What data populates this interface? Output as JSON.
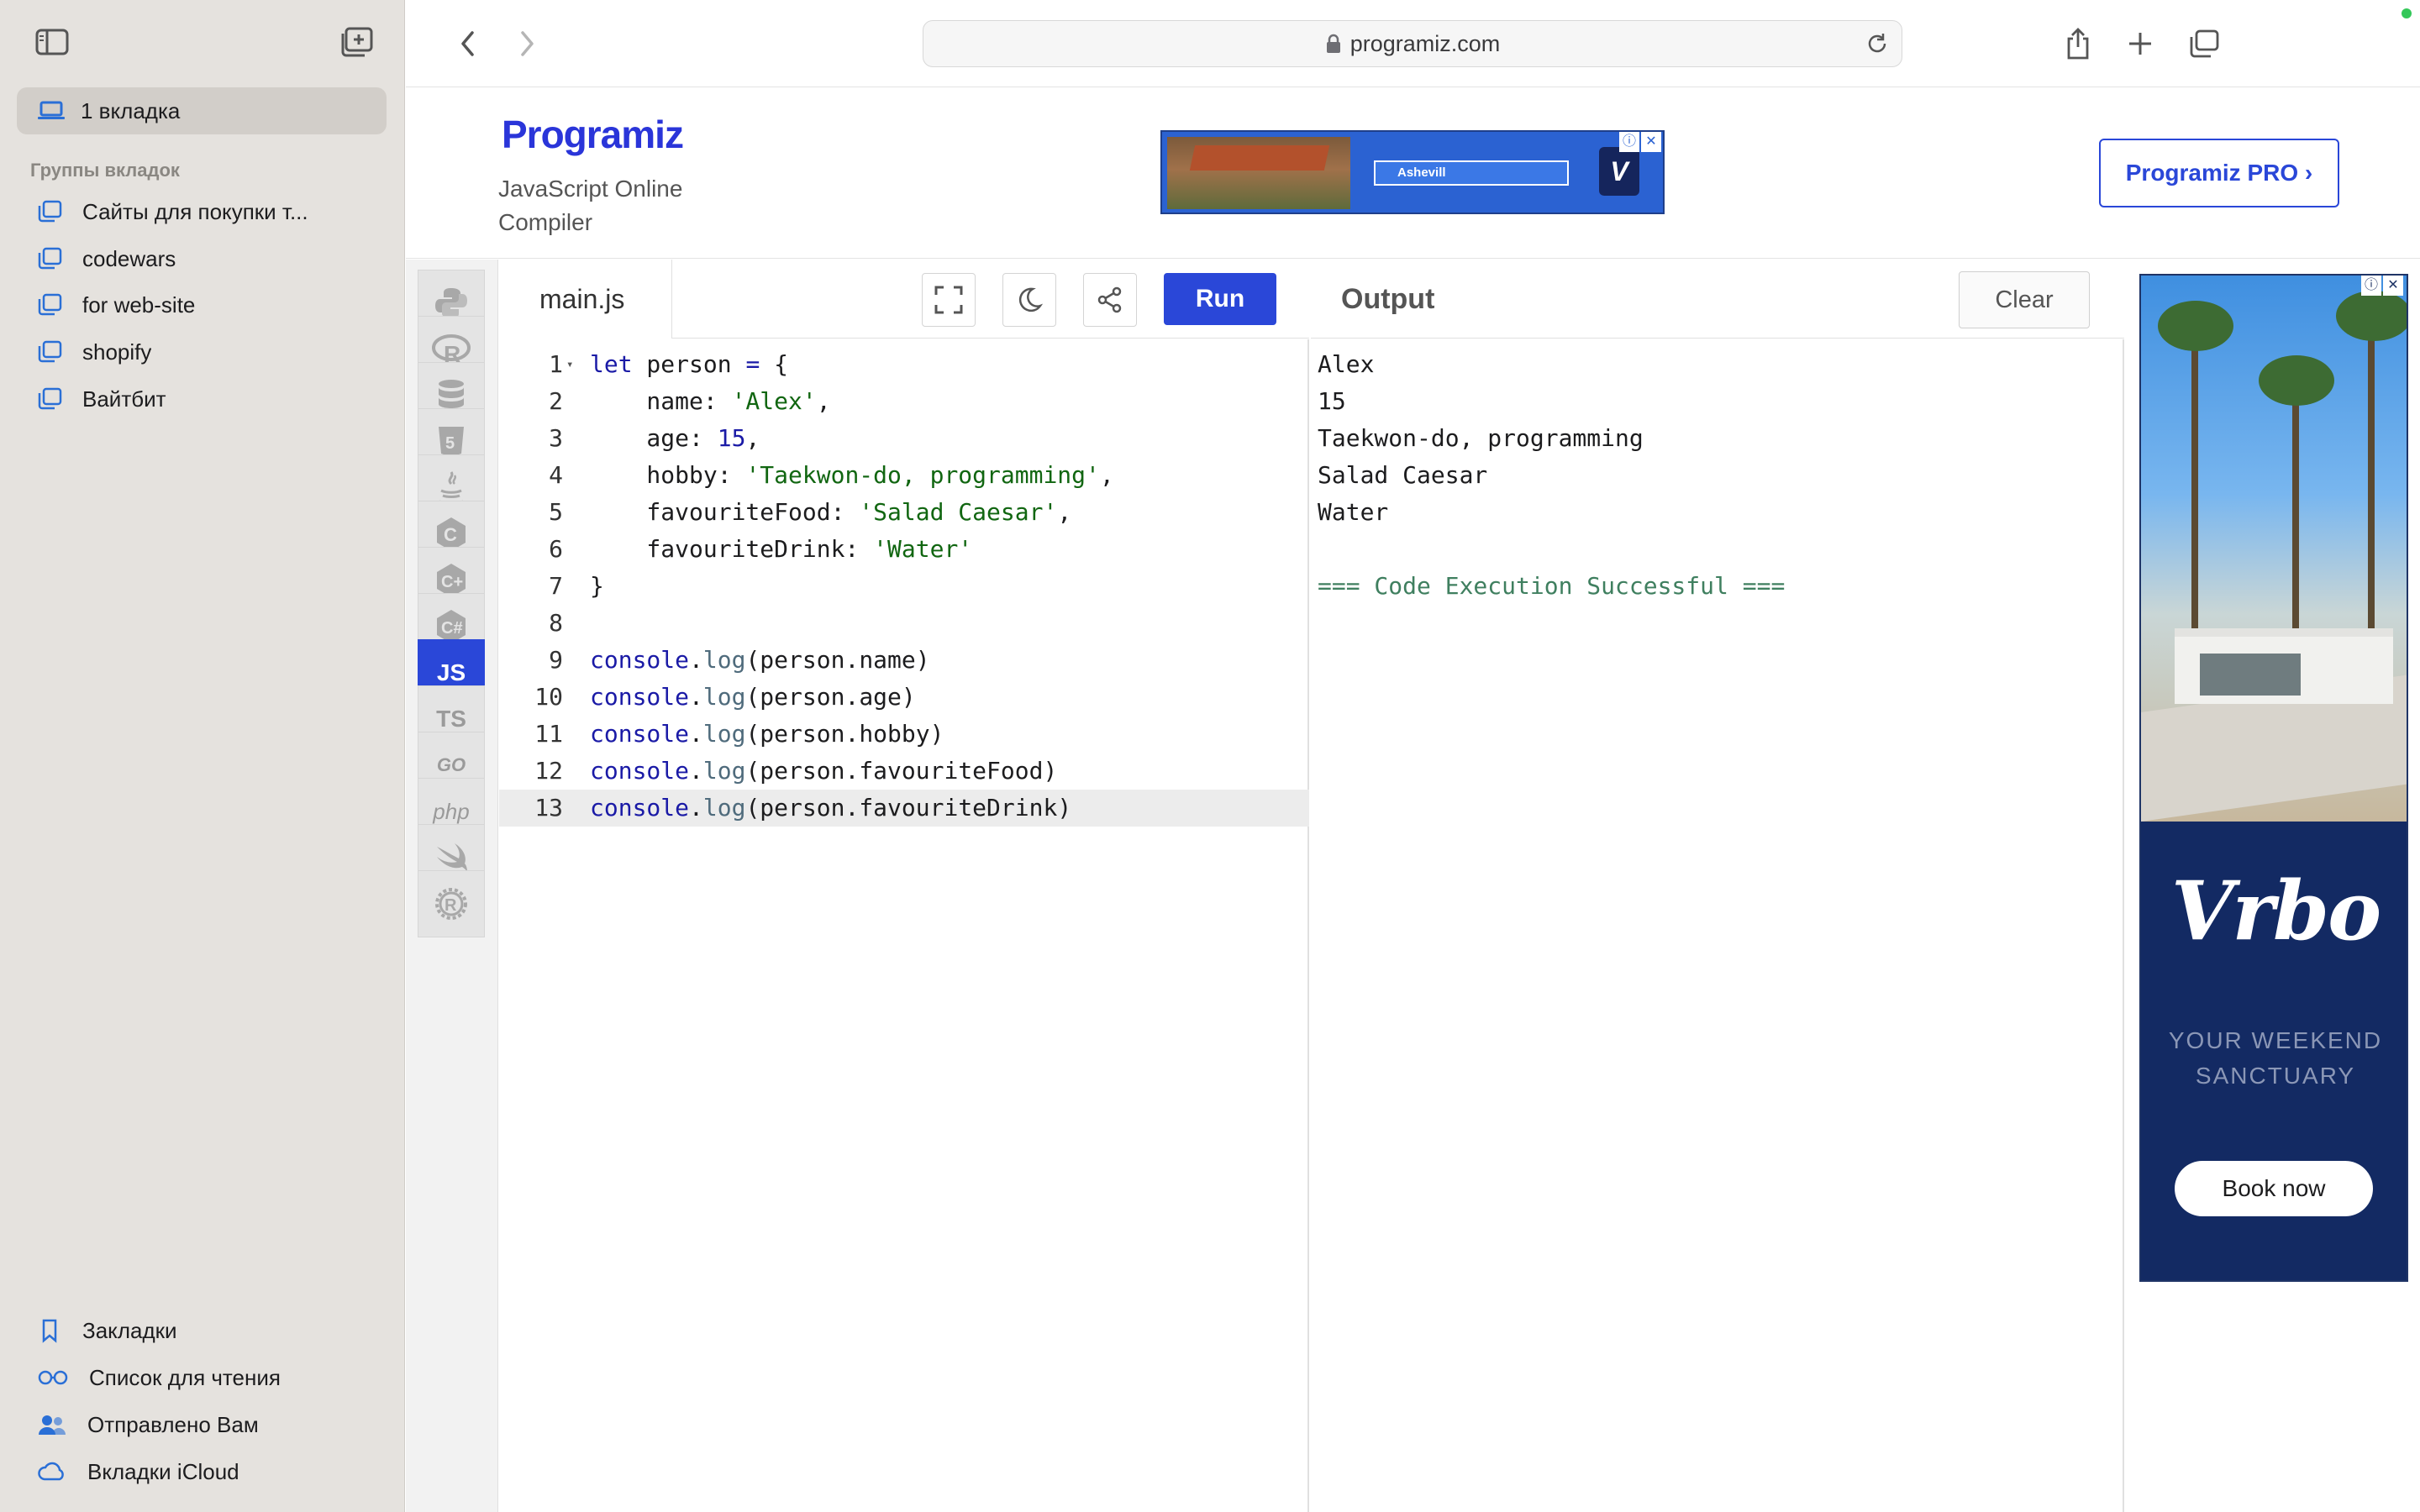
{
  "browser": {
    "url": "programiz.com"
  },
  "sidebar": {
    "active_tab_label": "1 вкладка",
    "group_section_label": "Группы вкладок",
    "groups": [
      {
        "label": "Сайты для покупки т..."
      },
      {
        "label": "codewars"
      },
      {
        "label": "for web-site"
      },
      {
        "label": "shopify"
      },
      {
        "label": "Вайтбит"
      }
    ],
    "bottom": [
      {
        "label": "Закладки",
        "icon": "bookmark-icon"
      },
      {
        "label": "Список для чтения",
        "icon": "reading-list-icon"
      },
      {
        "label": "Отправлено Вам",
        "icon": "shared-with-you-icon"
      },
      {
        "label": "Вкладки iCloud",
        "icon": "icloud-icon"
      }
    ]
  },
  "site": {
    "logo_text": "Programiz",
    "subtitle": "JavaScript Online Compiler",
    "pro_button": "Programiz PRO ›",
    "top_ad": {
      "field_text": "Ashevill"
    }
  },
  "languages": [
    {
      "name": "python",
      "icon": "python-icon",
      "label": ""
    },
    {
      "name": "r",
      "icon": "r-icon",
      "label": ""
    },
    {
      "name": "sql",
      "icon": "database-icon",
      "label": ""
    },
    {
      "name": "html",
      "icon": "html5-icon",
      "label": ""
    },
    {
      "name": "java",
      "icon": "java-icon",
      "label": ""
    },
    {
      "name": "c",
      "icon": "c-icon",
      "label": ""
    },
    {
      "name": "cpp",
      "icon": "cpp-icon",
      "label": ""
    },
    {
      "name": "csharp",
      "icon": "csharp-icon",
      "label": ""
    },
    {
      "name": "javascript",
      "icon": "js-icon",
      "label": "JS",
      "active": true
    },
    {
      "name": "typescript",
      "icon": "ts-icon",
      "label": "TS"
    },
    {
      "name": "go",
      "icon": "go-icon",
      "label": "GO"
    },
    {
      "name": "php",
      "icon": "php-icon",
      "label": "php"
    },
    {
      "name": "swift",
      "icon": "swift-icon",
      "label": ""
    },
    {
      "name": "rust",
      "icon": "rust-icon",
      "label": ""
    }
  ],
  "editor": {
    "filename": "main.js",
    "run_label": "Run",
    "current_line": 13,
    "lines": [
      [
        {
          "t": "kw",
          "v": "let"
        },
        {
          "t": "",
          "v": " person "
        },
        {
          "t": "kw",
          "v": "="
        },
        {
          "t": "",
          "v": " {"
        }
      ],
      [
        {
          "t": "",
          "v": "    name: "
        },
        {
          "t": "str",
          "v": "'Alex'"
        },
        {
          "t": "",
          "v": ","
        }
      ],
      [
        {
          "t": "",
          "v": "    age: "
        },
        {
          "t": "num",
          "v": "15"
        },
        {
          "t": "",
          "v": ","
        }
      ],
      [
        {
          "t": "",
          "v": "    hobby: "
        },
        {
          "t": "str",
          "v": "'Taekwon-do, programming'"
        },
        {
          "t": "",
          "v": ","
        }
      ],
      [
        {
          "t": "",
          "v": "    favouriteFood: "
        },
        {
          "t": "str",
          "v": "'Salad Caesar'"
        },
        {
          "t": "",
          "v": ","
        }
      ],
      [
        {
          "t": "",
          "v": "    favouriteDrink: "
        },
        {
          "t": "str",
          "v": "'Water'"
        }
      ],
      [
        {
          "t": "",
          "v": "}"
        }
      ],
      [],
      [
        {
          "t": "obj",
          "v": "console"
        },
        {
          "t": "",
          "v": "."
        },
        {
          "t": "fn",
          "v": "log"
        },
        {
          "t": "",
          "v": "(person.name)"
        }
      ],
      [
        {
          "t": "obj",
          "v": "console"
        },
        {
          "t": "",
          "v": "."
        },
        {
          "t": "fn",
          "v": "log"
        },
        {
          "t": "",
          "v": "(person.age)"
        }
      ],
      [
        {
          "t": "obj",
          "v": "console"
        },
        {
          "t": "",
          "v": "."
        },
        {
          "t": "fn",
          "v": "log"
        },
        {
          "t": "",
          "v": "(person.hobby)"
        }
      ],
      [
        {
          "t": "obj",
          "v": "console"
        },
        {
          "t": "",
          "v": "."
        },
        {
          "t": "fn",
          "v": "log"
        },
        {
          "t": "",
          "v": "(person.favouriteFood)"
        }
      ],
      [
        {
          "t": "obj",
          "v": "console"
        },
        {
          "t": "",
          "v": "."
        },
        {
          "t": "fn",
          "v": "log"
        },
        {
          "t": "",
          "v": "(person.favouriteDrink)"
        }
      ]
    ]
  },
  "output": {
    "title": "Output",
    "clear_label": "Clear",
    "lines": [
      "Alex",
      "15",
      "Taekwon-do, programming",
      "Salad Caesar",
      "Water",
      ""
    ],
    "success": "=== Code Execution Successful ==="
  },
  "side_ad": {
    "brand": "Vrbo",
    "tagline": "YOUR WEEKEND SANCTUARY",
    "cta": "Book now"
  },
  "colors": {
    "accent": "#2a47d8",
    "sidebar_bg": "#e5e2de"
  }
}
